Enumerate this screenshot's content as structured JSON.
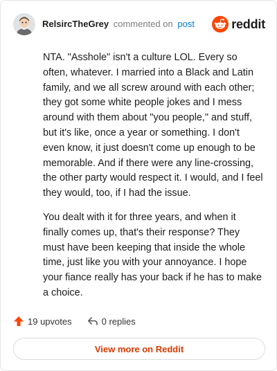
{
  "header": {
    "username": "RelsircTheGrey",
    "action": "commented on",
    "post_link": "post",
    "brand_word": "reddit",
    "avatar_icon": "user-avatar-icon",
    "brand_icon": "reddit-snoo-icon"
  },
  "comment": {
    "paragraphs": [
      "NTA. \"Asshole\" isn't a culture LOL. Every so often, whatever. I married into a Black and Latin family, and we all screw around with each other; they got some white people jokes and I mess around with them about \"you people,\" and stuff, but it's like, once a year or something. I don't even know, it just doesn't come up enough to be memorable. And if there were any line-crossing, the other party would respect it. I would, and I feel they would, too, if I had the issue.",
      "You dealt with it for three years, and when it finally comes up, that's their response? They must have been keeping that inside the whole time, just like you with your annoyance. I hope your fiance really has your back if he has to make a choice."
    ]
  },
  "footer": {
    "upvotes": "19 upvotes",
    "replies": "0 replies",
    "upvote_icon": "upvote-arrow-icon",
    "reply_icon": "reply-arrow-icon"
  },
  "view_more": "View more on Reddit",
  "colors": {
    "link": "#0079d3",
    "brand_orange": "#ff4500",
    "view_more_text": "#d93a00"
  }
}
